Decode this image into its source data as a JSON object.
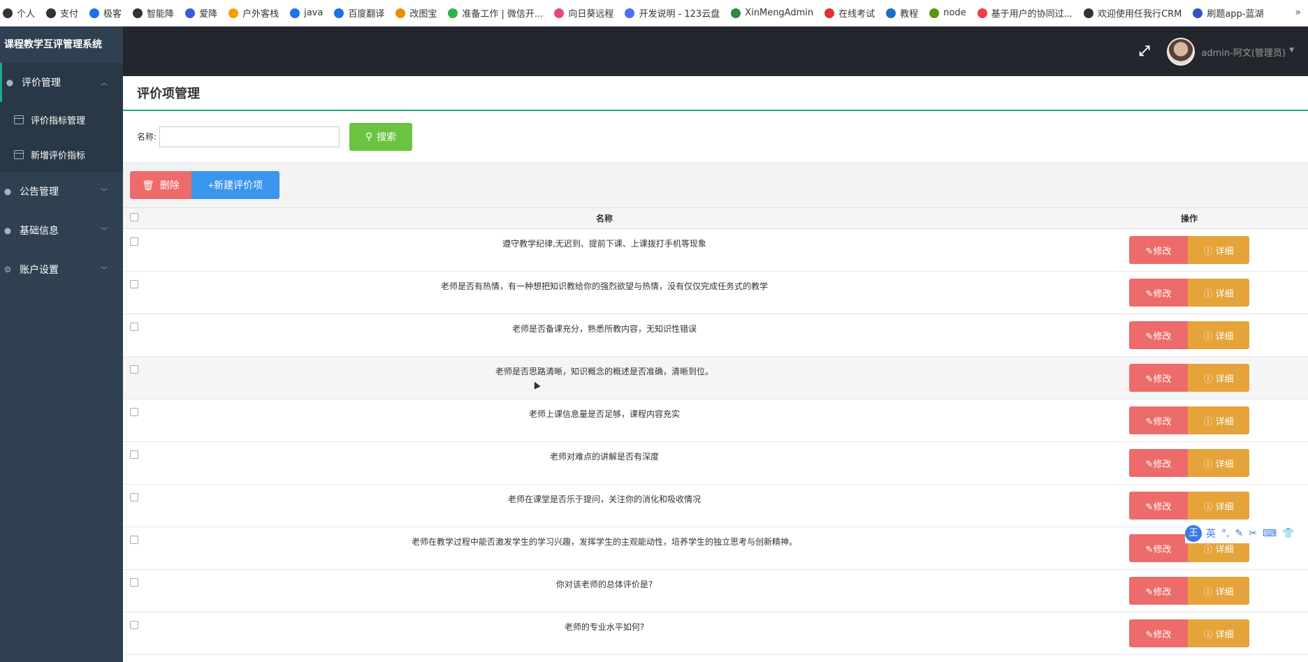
{
  "bookmarks": [
    {
      "label": "个人",
      "color": "#333333"
    },
    {
      "label": "支付",
      "color": "#333333"
    },
    {
      "label": "极客",
      "color": "#1a73e8"
    },
    {
      "label": "智能降",
      "color": "#333333"
    },
    {
      "label": "爱降",
      "color": "#3b5bdb"
    },
    {
      "label": "户外客栈",
      "color": "#f59f00"
    },
    {
      "label": "java",
      "color": "#1a73e8"
    },
    {
      "label": "百度翻译",
      "color": "#1a73e8"
    },
    {
      "label": "改图宝",
      "color": "#f08c00"
    },
    {
      "label": "准备工作 | 微信开...",
      "color": "#2fb344"
    },
    {
      "label": "向日葵远程",
      "color": "#e64980"
    },
    {
      "label": "开发说明 - 123云盘",
      "color": "#4c6ef5"
    },
    {
      "label": "XinMengAdmin",
      "color": "#2b8a3e"
    },
    {
      "label": "在线考试",
      "color": "#e03131"
    },
    {
      "label": "教程",
      "color": "#1971c2"
    },
    {
      "label": "node",
      "color": "#5c940d"
    },
    {
      "label": "基于用户的协同过...",
      "color": "#f03e3e"
    },
    {
      "label": "欢迎使用任我行CRM",
      "color": "#333333"
    },
    {
      "label": "刷题app-蓝湖",
      "color": "#364fc7"
    }
  ],
  "bookmarks_more": "»",
  "sidebar": {
    "brand": "课程教学互评管理系统",
    "groups": [
      {
        "label": "评价管理",
        "icon": "map-marker-icon"
      },
      {
        "label": "公告管理",
        "icon": "map-marker-icon"
      },
      {
        "label": "基础信息",
        "icon": "map-marker-icon"
      },
      {
        "label": "账户设置",
        "icon": "gear-icon"
      }
    ],
    "subitems": [
      {
        "label": "评价指标管理"
      },
      {
        "label": "新增评价指标"
      }
    ]
  },
  "header": {
    "user": "admin-阿文(管理员)"
  },
  "page": {
    "title": "评价项管理",
    "search_label": "名称:",
    "search_value": "",
    "search_button": "搜索",
    "delete_button": "删除",
    "add_button": "+新建评价项"
  },
  "table": {
    "headers": {
      "name": "名称",
      "ops": "操作"
    },
    "edit_label": "修改",
    "detail_label": "详细",
    "rows": [
      {
        "name": "遵守教学纪律,无迟到、提前下课、上课拨打手机等现象"
      },
      {
        "name": "老师是否有热情，有一种想把知识教给你的强烈欲望与热情，没有仅仅完成任务式的教学"
      },
      {
        "name": "老师是否备课充分，熟悉所教内容，无知识性错误"
      },
      {
        "name": "老师是否思路清晰，知识概念的概述是否准确，清晰到位。"
      },
      {
        "name": "老师上课信息量是否足够，课程内容充实"
      },
      {
        "name": "老师对难点的讲解是否有深度"
      },
      {
        "name": "老师在课堂是否乐于提问，关注你的消化和吸收情况"
      },
      {
        "name": "老师在教学过程中能否激发学生的学习兴趣，发挥学生的主观能动性，培养学生的独立思考与创新精神。"
      },
      {
        "name": "你对该老师的总体评价是?"
      },
      {
        "name": "老师的专业水平如何?"
      }
    ]
  },
  "ime": {
    "logo": "王",
    "mode": "英"
  }
}
